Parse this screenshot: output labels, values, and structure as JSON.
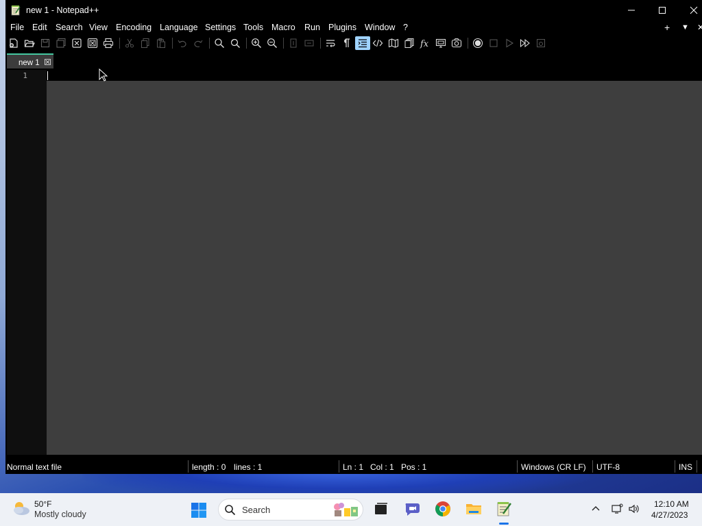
{
  "window": {
    "title": "new 1 - Notepad++",
    "controls": [
      "minimize",
      "maximize",
      "close"
    ]
  },
  "menubar": {
    "items": [
      "File",
      "Edit",
      "Search",
      "View",
      "Encoding",
      "Language",
      "Settings",
      "Tools",
      "Macro",
      "Run",
      "Plugins",
      "Window",
      "?"
    ],
    "right_plus": "+",
    "right_arrow": "▼",
    "right_close": "✕"
  },
  "toolbar": {
    "icons": [
      "new-file-icon",
      "open-file-icon",
      "save-icon",
      "save-all-icon",
      "close-icon",
      "close-all-icon",
      "print-icon",
      "cut-icon",
      "copy-icon",
      "paste-icon",
      "undo-icon",
      "redo-icon",
      "find-icon",
      "replace-icon",
      "zoom-in-icon",
      "zoom-out-icon",
      "sync-vertical-icon",
      "sync-horizontal-icon",
      "word-wrap-icon",
      "show-all-characters-icon",
      "indent-guide-icon",
      "xml-tag-icon",
      "document-map-icon",
      "document-list-icon",
      "function-list-icon",
      "folder-as-workspace-icon",
      "monitoring-icon",
      "record-macro-icon",
      "stop-macro-icon",
      "play-macro-icon",
      "run-macro-multiple-icon",
      "save-macro-icon"
    ]
  },
  "tabs": [
    {
      "label": "new 1",
      "active": true
    }
  ],
  "editor": {
    "line_numbers": [
      "1"
    ],
    "content": ""
  },
  "statusbar": {
    "file_type": "Normal text file",
    "length": "length : 0",
    "lines": "lines : 1",
    "ln": "Ln : 1",
    "col": "Col : 1",
    "pos": "Pos : 1",
    "eol": "Windows (CR LF)",
    "encoding": "UTF-8",
    "mode": "INS"
  },
  "taskbar": {
    "weather": {
      "temp": "50°F",
      "desc": "Mostly cloudy"
    },
    "search_label": "Search",
    "clock": {
      "time": "12:10 AM",
      "date": "4/27/2023"
    }
  },
  "colors": {
    "tab_accent": "#45c8a0",
    "editor_bg": "#3e3e3e",
    "gutter_bg": "#0f0f0f",
    "highlight_button": "#9fd3ff"
  }
}
